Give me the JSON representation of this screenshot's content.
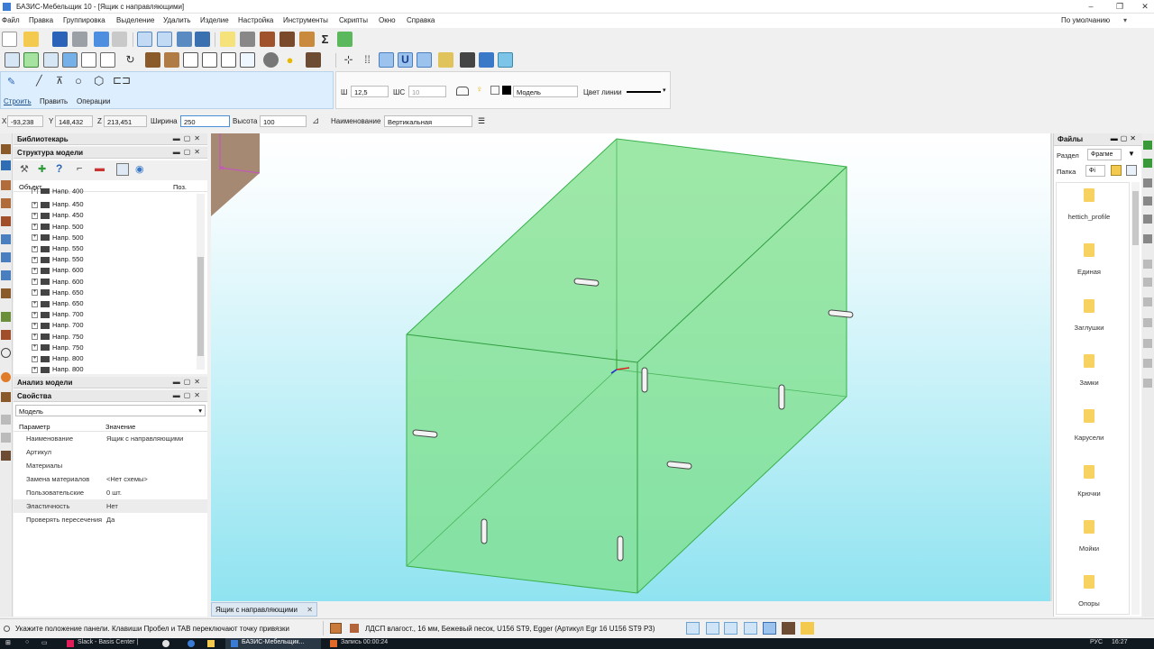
{
  "window": {
    "title": "БАЗИС-Мебельщик 10 - [Ящик с направляющими]",
    "profile": "По умолчанию"
  },
  "menu": [
    "Файл",
    "Правка",
    "Группировка",
    "Выделение",
    "Удалить",
    "Изделие",
    "Настройка",
    "Инструменты",
    "Скрипты",
    "Окно",
    "Справка"
  ],
  "mode_tabs": [
    "Строить",
    "Править",
    "Операции"
  ],
  "props_toolbar": {
    "w_label": "Ш",
    "w_value": "12,5",
    "shs_label": "ШС",
    "shs_value": "10",
    "layer_value": "Модель",
    "line_color_label": "Цвет линии"
  },
  "coords": {
    "x_label": "X",
    "x_value": "-93,238",
    "y_label": "Y",
    "y_value": "148,432",
    "z_label": "Z",
    "z_value": "213,451",
    "width_label": "Ширина",
    "width_value": "250",
    "height_label": "Высота",
    "height_value": "100",
    "name_label": "Наименование",
    "name_value": "Вертикальная"
  },
  "librarian": {
    "title": "Библиотекарь"
  },
  "structure": {
    "title": "Структура модели",
    "col_object": "Объект",
    "col_pos": "Поз.",
    "rows": [
      "Напр. 400",
      "Напр. 450",
      "Напр. 450",
      "Напр. 500",
      "Напр. 500",
      "Напр. 550",
      "Напр. 550",
      "Напр. 600",
      "Напр. 600",
      "Напр. 650",
      "Напр. 650",
      "Напр. 700",
      "Напр. 700",
      "Напр. 750",
      "Напр. 750",
      "Напр. 800",
      "Напр. 800"
    ]
  },
  "analysis": {
    "title": "Анализ модели"
  },
  "properties": {
    "title": "Свойства",
    "selector": "Модель",
    "col_param": "Параметр",
    "col_value": "Значение",
    "rows": [
      {
        "k": "Наименование",
        "v": "Ящик с направляющими"
      },
      {
        "k": "Артикул",
        "v": ""
      },
      {
        "k": "Материалы",
        "v": ""
      },
      {
        "k": "Замена материалов",
        "v": "<Нет схемы>"
      },
      {
        "k": "Пользовательские",
        "v": "0 шт."
      },
      {
        "k": "Эластичность",
        "v": "Нет"
      },
      {
        "k": "Проверять пересечения",
        "v": "Да"
      }
    ]
  },
  "document_tab": "Ящик с направляющими",
  "files": {
    "title": "Файлы",
    "section_label": "Раздел",
    "section_value": "Фрагме",
    "folder_label": "Папка",
    "folder_value": "Фі",
    "items": [
      "hettich_profile",
      "Единая",
      "Заглушки",
      "Замки",
      "Карусели",
      "Крючки",
      "Мойки",
      "Опоры"
    ]
  },
  "status": {
    "hint": "Укажите положение панели. Клавиши Пробел и TAB переключают точку привязки",
    "material": "ЛДСП влагост., 16 мм, Бежевый песок, U156 ST9, Egger (Артикул Egr 16 U156 ST9 P3)"
  },
  "taskbar": {
    "items": [
      "Slack - Basis Center |",
      "БАЗИС-Мебельщик...",
      "Запись 00:00:24"
    ],
    "lang": "РУС",
    "clock": "16:27"
  },
  "colors": {
    "accent": "#1a73c8",
    "model_fill": "#7ee08a",
    "viewport_bottom": "#8fe3f0"
  }
}
